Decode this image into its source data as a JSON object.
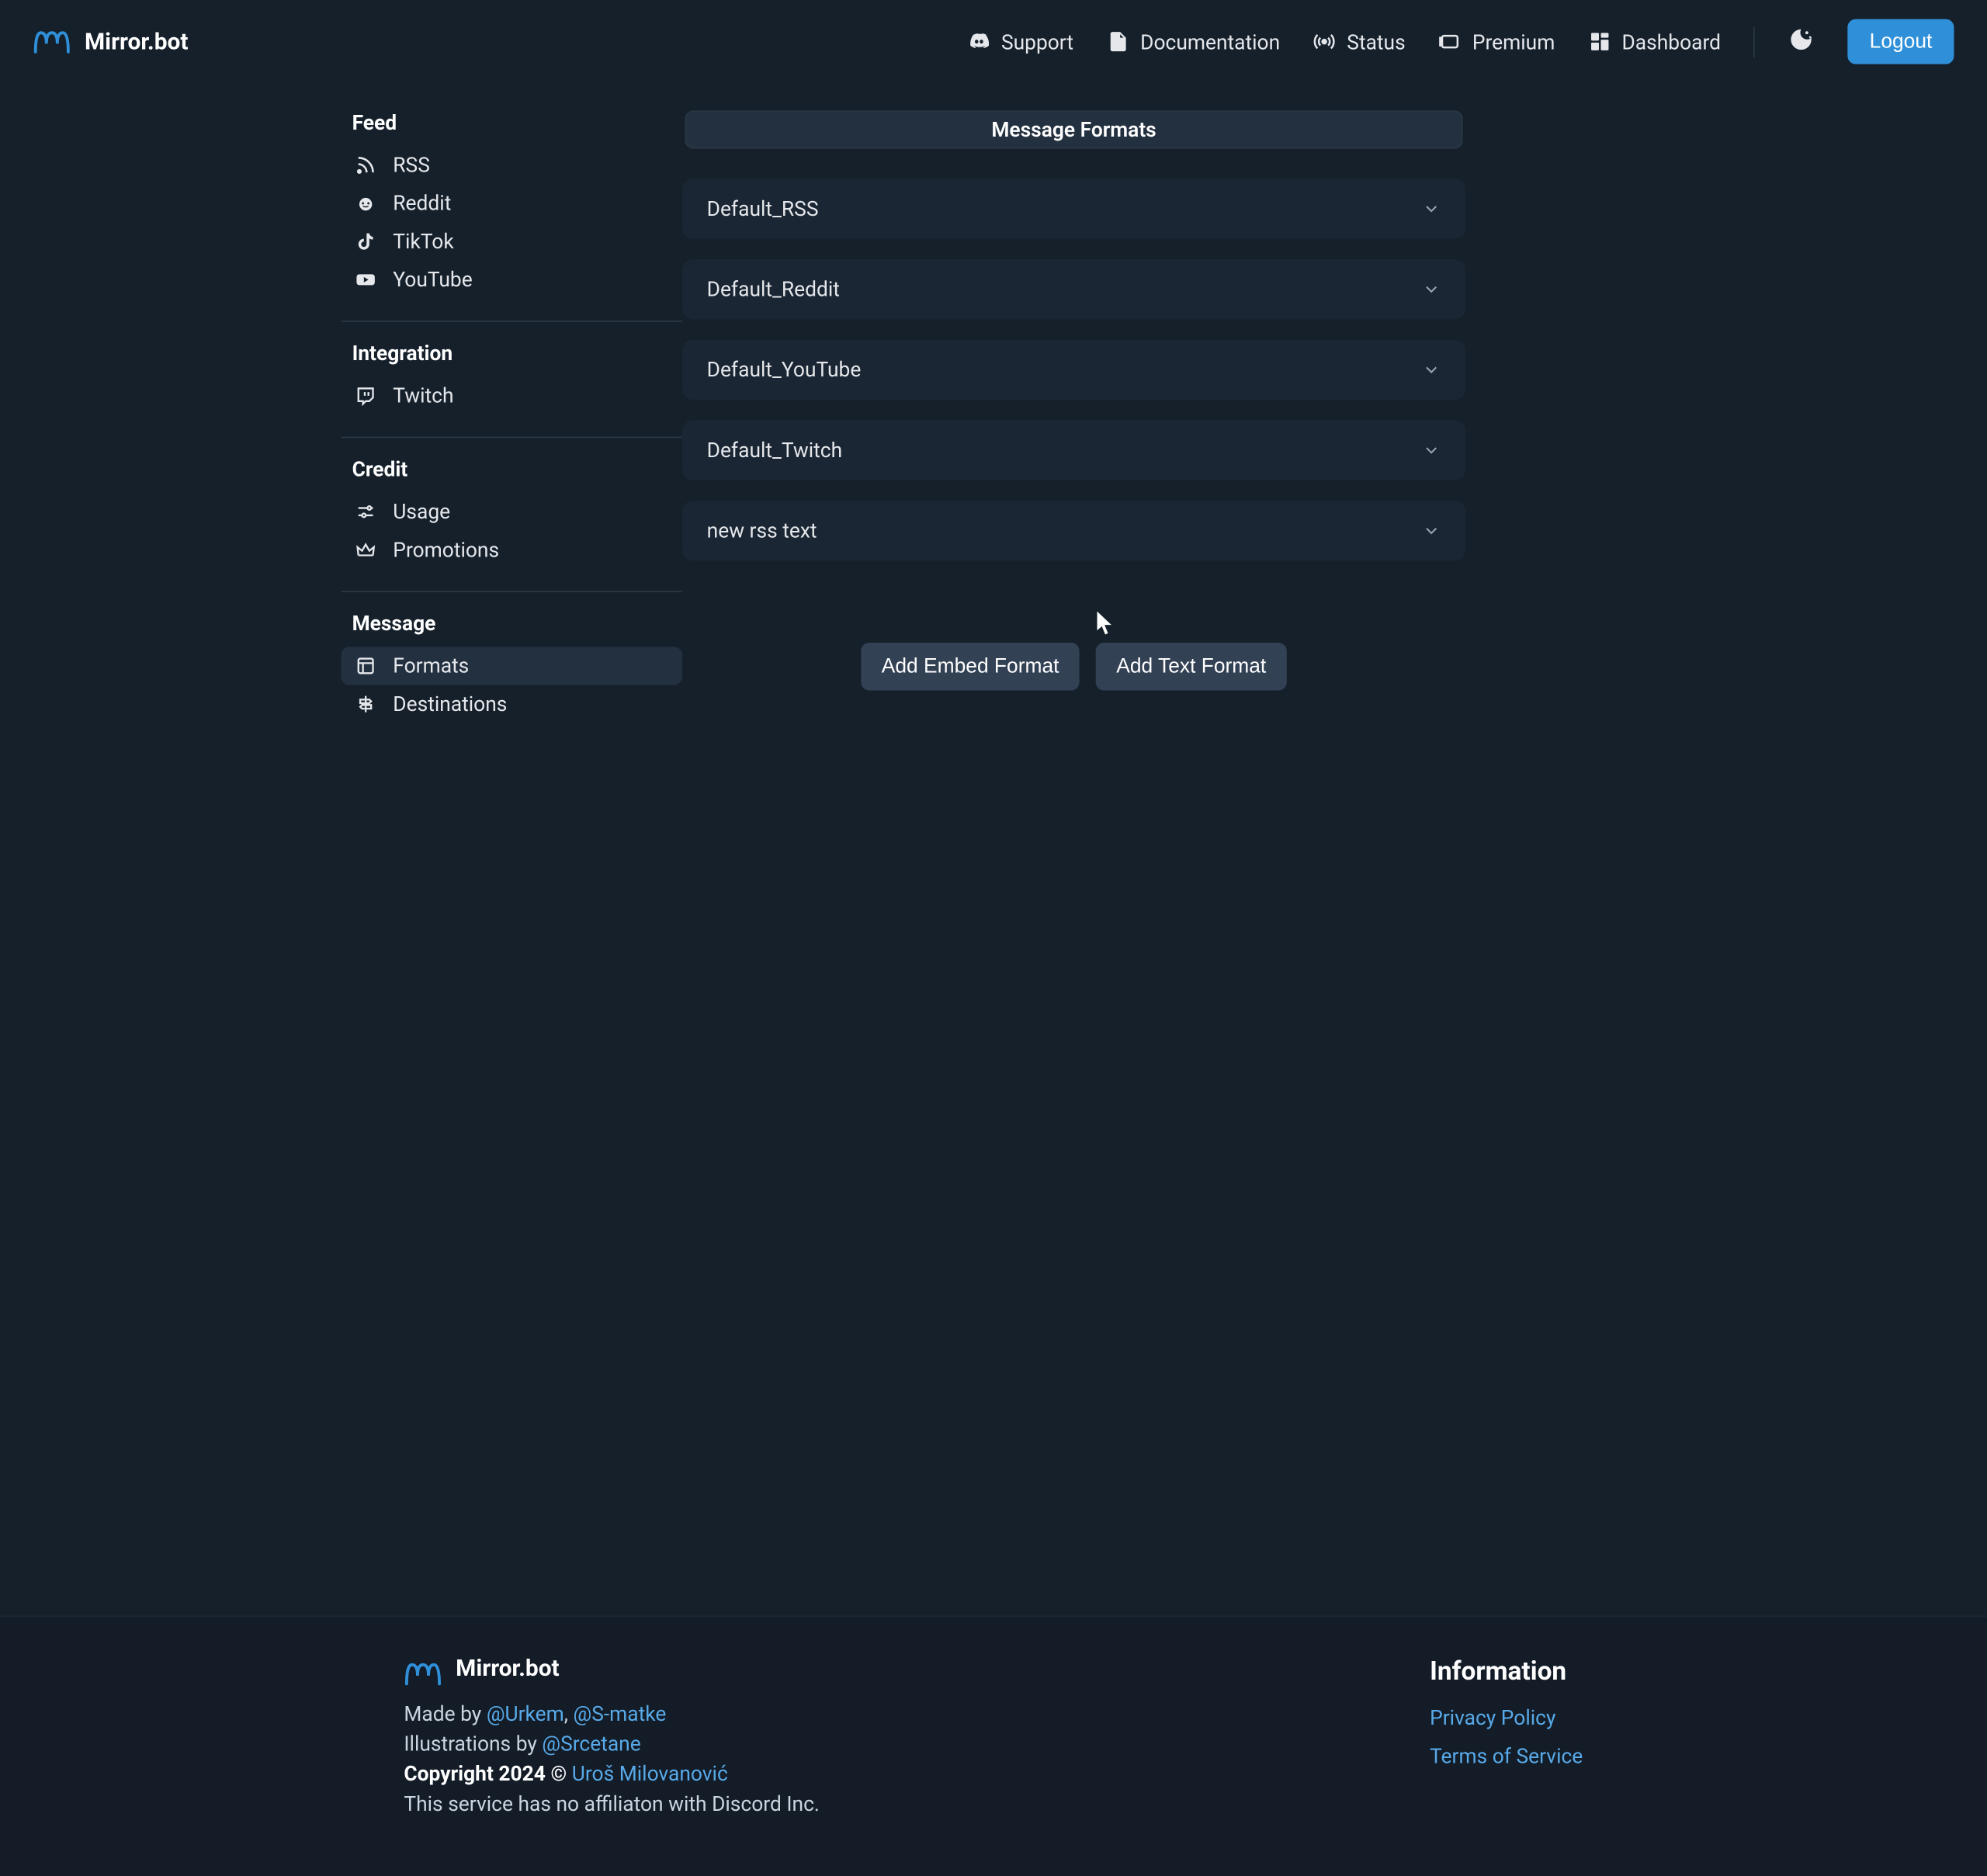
{
  "brand": {
    "name": "Mirror.bot",
    "accent": "#2f90d9"
  },
  "nav": {
    "support": "Support",
    "documentation": "Documentation",
    "status": "Status",
    "premium": "Premium",
    "dashboard": "Dashboard",
    "logout": "Logout"
  },
  "sidebar": {
    "feed": {
      "heading": "Feed",
      "items": [
        {
          "label": "RSS"
        },
        {
          "label": "Reddit"
        },
        {
          "label": "TikTok"
        },
        {
          "label": "YouTube"
        }
      ]
    },
    "integration": {
      "heading": "Integration",
      "items": [
        {
          "label": "Twitch"
        }
      ]
    },
    "credit": {
      "heading": "Credit",
      "items": [
        {
          "label": "Usage"
        },
        {
          "label": "Promotions"
        }
      ]
    },
    "message": {
      "heading": "Message",
      "items": [
        {
          "label": "Formats"
        },
        {
          "label": "Destinations"
        }
      ]
    }
  },
  "main": {
    "title": "Message Formats",
    "formats": [
      {
        "label": "Default_RSS"
      },
      {
        "label": "Default_Reddit"
      },
      {
        "label": "Default_YouTube"
      },
      {
        "label": "Default_Twitch"
      },
      {
        "label": "new rss text"
      }
    ],
    "add_embed": "Add Embed Format",
    "add_text": "Add Text Format"
  },
  "footer": {
    "brand": "Mirror.bot",
    "made_by_prefix": "Made by ",
    "made_by_1": "@Urkem",
    "made_by_sep": ", ",
    "made_by_2": "@S-matke",
    "illus_prefix": "Illustrations by ",
    "illus_by": "@Srcetane",
    "copyright_prefix": "Copyright 2024 © ",
    "copyright_name": "Uroš Milovanović",
    "disclaimer": "This service has no affiliaton with Discord Inc.",
    "info_heading": "Information",
    "privacy": "Privacy Policy",
    "terms": "Terms of Service"
  }
}
